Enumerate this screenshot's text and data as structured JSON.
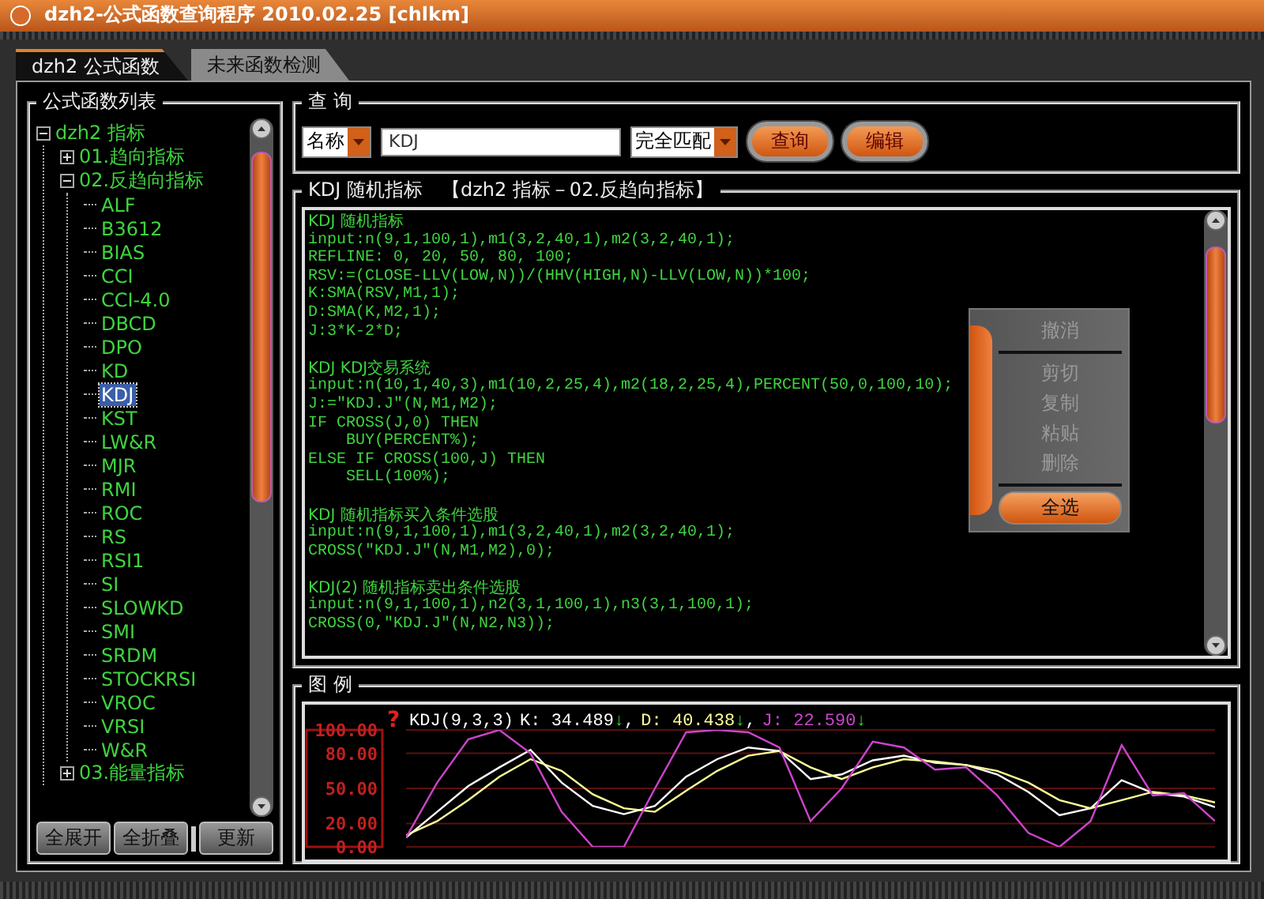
{
  "window": {
    "title": "dzh2-公式函数查询程序 2010.02.25 [chlkm]"
  },
  "tabs": [
    {
      "label": "dzh2 公式函数",
      "selected": true
    },
    {
      "label": "未来函数检测",
      "selected": false
    }
  ],
  "formula_list": {
    "title": "公式函数列表",
    "tree": [
      {
        "label": "dzh2 指标",
        "expanded": true,
        "selected": false,
        "children": [
          {
            "label": "01.趋向指标",
            "expanded": false,
            "selected": false
          },
          {
            "label": "02.反趋向指标",
            "expanded": true,
            "selected": false,
            "children": [
              {
                "label": "ALF",
                "selected": false
              },
              {
                "label": "B3612",
                "selected": false
              },
              {
                "label": "BIAS",
                "selected": false
              },
              {
                "label": "CCI",
                "selected": false
              },
              {
                "label": "CCI-4.0",
                "selected": false
              },
              {
                "label": "DBCD",
                "selected": false
              },
              {
                "label": "DPO",
                "selected": false
              },
              {
                "label": "KD",
                "selected": false
              },
              {
                "label": "KDJ",
                "selected": true
              },
              {
                "label": "KST",
                "selected": false
              },
              {
                "label": "LW&R",
                "selected": false
              },
              {
                "label": "MJR",
                "selected": false
              },
              {
                "label": "RMI",
                "selected": false
              },
              {
                "label": "ROC",
                "selected": false
              },
              {
                "label": "RS",
                "selected": false
              },
              {
                "label": "RSI1",
                "selected": false
              },
              {
                "label": "SI",
                "selected": false
              },
              {
                "label": "SLOWKD",
                "selected": false
              },
              {
                "label": "SMI",
                "selected": false
              },
              {
                "label": "SRDM",
                "selected": false
              },
              {
                "label": "STOCKRSI",
                "selected": false
              },
              {
                "label": "VROC",
                "selected": false
              },
              {
                "label": "VRSI",
                "selected": false
              },
              {
                "label": "W&R",
                "selected": false
              }
            ]
          },
          {
            "label": "03.能量指标",
            "expanded": false,
            "selected": false
          }
        ]
      }
    ],
    "buttons": [
      "全展开",
      "全折叠",
      "更新"
    ]
  },
  "query": {
    "title": "查 询",
    "field_type": "名称",
    "value": "KDJ",
    "match_mode": "完全匹配",
    "buttons": [
      "查询",
      "编辑"
    ]
  },
  "formula": {
    "title": "KDJ 随机指标　【dzh2 指标－02.反趋向指标】",
    "blocks": [
      [
        "KDJ 随机指标",
        "input:n(9,1,100,1),m1(3,2,40,1),m2(3,2,40,1);",
        "REFLINE: 0, 20, 50, 80, 100;",
        "RSV:=(CLOSE-LLV(LOW,N))/(HHV(HIGH,N)-LLV(LOW,N))*100;",
        "K:SMA(RSV,M1,1);",
        "D:SMA(K,M2,1);",
        "J:3*K-2*D;"
      ],
      [
        "KDJ KDJ交易系统",
        "input:n(10,1,40,3),m1(10,2,25,4),m2(18,2,25,4),PERCENT(50,0,100,10);",
        "J:=\"KDJ.J\"(N,M1,M2);",
        "IF CROSS(J,0) THEN",
        "    BUY(PERCENT%);",
        "ELSE IF CROSS(100,J) THEN",
        "    SELL(100%);"
      ],
      [
        "KDJ 随机指标买入条件选股",
        "input:n(9,1,100,1),m1(3,2,40,1),m2(3,2,40,1);",
        "CROSS(\"KDJ.J\"(N,M1,M2),0);"
      ],
      [
        "KDJ(2) 随机指标卖出条件选股",
        "input:n(9,1,100,1),n2(3,1,100,1),n3(3,1,100,1);",
        "CROSS(0,\"KDJ.J\"(N,N2,N3));"
      ]
    ],
    "context_menu": [
      {
        "kind": "item",
        "label": "撤消",
        "disabled": true
      },
      {
        "kind": "separator"
      },
      {
        "kind": "item",
        "label": "剪切",
        "disabled": true
      },
      {
        "kind": "item",
        "label": "复制",
        "disabled": true
      },
      {
        "kind": "item",
        "label": "粘贴",
        "disabled": true
      },
      {
        "kind": "item",
        "label": "删除",
        "disabled": true
      },
      {
        "kind": "separator"
      },
      {
        "kind": "item",
        "label": "全选",
        "disabled": false
      }
    ]
  },
  "legend": {
    "title": "图 例",
    "help_mark": "?",
    "indicator": "KDJ(9,3,3)",
    "readings": [
      {
        "value": ": 34.489",
        "arrow": "↓",
        "suffix": ","
      },
      {
        "value": ": 40.438",
        "arrow": "↓",
        "suffix": ","
      },
      {
        "value": ": 22.590",
        "arrow": "↓"
      }
    ],
    "chart_data": {
      "type": "line",
      "grid": true,
      "ylim": [
        0,
        100
      ],
      "yticks": [
        {
          "value": 0,
          "label": "0.00"
        },
        {
          "value": 20,
          "label": "20.00"
        },
        {
          "value": 50,
          "label": "50.00"
        },
        {
          "value": 80,
          "label": "80.00"
        },
        {
          "value": 100,
          "label": "100.00"
        }
      ],
      "series": [
        {
          "name": "K",
          "color": "#ffffff",
          "values": [
            8,
            30,
            52,
            68,
            83,
            55,
            35,
            28,
            35,
            60,
            75,
            85,
            82,
            58,
            62,
            74,
            78,
            72,
            70,
            62,
            47,
            27,
            33,
            57,
            46,
            43,
            34
          ]
        },
        {
          "name": "D",
          "color": "#ffff99",
          "values": [
            10,
            22,
            40,
            60,
            75,
            65,
            45,
            33,
            30,
            48,
            65,
            78,
            82,
            68,
            58,
            68,
            75,
            73,
            70,
            65,
            55,
            40,
            33,
            40,
            47,
            44,
            38
          ]
        },
        {
          "name": "J",
          "color": "#cc44cc",
          "values": [
            8,
            55,
            92,
            100,
            80,
            30,
            0,
            0,
            50,
            98,
            100,
            98,
            85,
            22,
            50,
            90,
            85,
            66,
            68,
            44,
            12,
            0,
            22,
            87,
            44,
            46,
            22
          ]
        }
      ]
    }
  }
}
